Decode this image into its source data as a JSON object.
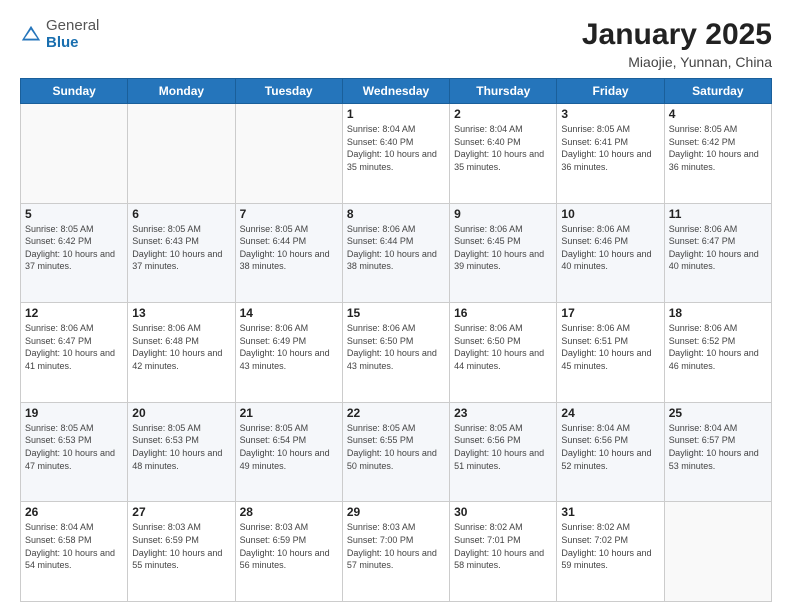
{
  "header": {
    "logo_general": "General",
    "logo_blue": "Blue",
    "title": "January 2025",
    "subtitle": "Miaojie, Yunnan, China"
  },
  "weekdays": [
    "Sunday",
    "Monday",
    "Tuesday",
    "Wednesday",
    "Thursday",
    "Friday",
    "Saturday"
  ],
  "weeks": [
    [
      {
        "day": "",
        "sunrise": "",
        "sunset": "",
        "daylight": ""
      },
      {
        "day": "",
        "sunrise": "",
        "sunset": "",
        "daylight": ""
      },
      {
        "day": "",
        "sunrise": "",
        "sunset": "",
        "daylight": ""
      },
      {
        "day": "1",
        "sunrise": "Sunrise: 8:04 AM",
        "sunset": "Sunset: 6:40 PM",
        "daylight": "Daylight: 10 hours and 35 minutes."
      },
      {
        "day": "2",
        "sunrise": "Sunrise: 8:04 AM",
        "sunset": "Sunset: 6:40 PM",
        "daylight": "Daylight: 10 hours and 35 minutes."
      },
      {
        "day": "3",
        "sunrise": "Sunrise: 8:05 AM",
        "sunset": "Sunset: 6:41 PM",
        "daylight": "Daylight: 10 hours and 36 minutes."
      },
      {
        "day": "4",
        "sunrise": "Sunrise: 8:05 AM",
        "sunset": "Sunset: 6:42 PM",
        "daylight": "Daylight: 10 hours and 36 minutes."
      }
    ],
    [
      {
        "day": "5",
        "sunrise": "Sunrise: 8:05 AM",
        "sunset": "Sunset: 6:42 PM",
        "daylight": "Daylight: 10 hours and 37 minutes."
      },
      {
        "day": "6",
        "sunrise": "Sunrise: 8:05 AM",
        "sunset": "Sunset: 6:43 PM",
        "daylight": "Daylight: 10 hours and 37 minutes."
      },
      {
        "day": "7",
        "sunrise": "Sunrise: 8:05 AM",
        "sunset": "Sunset: 6:44 PM",
        "daylight": "Daylight: 10 hours and 38 minutes."
      },
      {
        "day": "8",
        "sunrise": "Sunrise: 8:06 AM",
        "sunset": "Sunset: 6:44 PM",
        "daylight": "Daylight: 10 hours and 38 minutes."
      },
      {
        "day": "9",
        "sunrise": "Sunrise: 8:06 AM",
        "sunset": "Sunset: 6:45 PM",
        "daylight": "Daylight: 10 hours and 39 minutes."
      },
      {
        "day": "10",
        "sunrise": "Sunrise: 8:06 AM",
        "sunset": "Sunset: 6:46 PM",
        "daylight": "Daylight: 10 hours and 40 minutes."
      },
      {
        "day": "11",
        "sunrise": "Sunrise: 8:06 AM",
        "sunset": "Sunset: 6:47 PM",
        "daylight": "Daylight: 10 hours and 40 minutes."
      }
    ],
    [
      {
        "day": "12",
        "sunrise": "Sunrise: 8:06 AM",
        "sunset": "Sunset: 6:47 PM",
        "daylight": "Daylight: 10 hours and 41 minutes."
      },
      {
        "day": "13",
        "sunrise": "Sunrise: 8:06 AM",
        "sunset": "Sunset: 6:48 PM",
        "daylight": "Daylight: 10 hours and 42 minutes."
      },
      {
        "day": "14",
        "sunrise": "Sunrise: 8:06 AM",
        "sunset": "Sunset: 6:49 PM",
        "daylight": "Daylight: 10 hours and 43 minutes."
      },
      {
        "day": "15",
        "sunrise": "Sunrise: 8:06 AM",
        "sunset": "Sunset: 6:50 PM",
        "daylight": "Daylight: 10 hours and 43 minutes."
      },
      {
        "day": "16",
        "sunrise": "Sunrise: 8:06 AM",
        "sunset": "Sunset: 6:50 PM",
        "daylight": "Daylight: 10 hours and 44 minutes."
      },
      {
        "day": "17",
        "sunrise": "Sunrise: 8:06 AM",
        "sunset": "Sunset: 6:51 PM",
        "daylight": "Daylight: 10 hours and 45 minutes."
      },
      {
        "day": "18",
        "sunrise": "Sunrise: 8:06 AM",
        "sunset": "Sunset: 6:52 PM",
        "daylight": "Daylight: 10 hours and 46 minutes."
      }
    ],
    [
      {
        "day": "19",
        "sunrise": "Sunrise: 8:05 AM",
        "sunset": "Sunset: 6:53 PM",
        "daylight": "Daylight: 10 hours and 47 minutes."
      },
      {
        "day": "20",
        "sunrise": "Sunrise: 8:05 AM",
        "sunset": "Sunset: 6:53 PM",
        "daylight": "Daylight: 10 hours and 48 minutes."
      },
      {
        "day": "21",
        "sunrise": "Sunrise: 8:05 AM",
        "sunset": "Sunset: 6:54 PM",
        "daylight": "Daylight: 10 hours and 49 minutes."
      },
      {
        "day": "22",
        "sunrise": "Sunrise: 8:05 AM",
        "sunset": "Sunset: 6:55 PM",
        "daylight": "Daylight: 10 hours and 50 minutes."
      },
      {
        "day": "23",
        "sunrise": "Sunrise: 8:05 AM",
        "sunset": "Sunset: 6:56 PM",
        "daylight": "Daylight: 10 hours and 51 minutes."
      },
      {
        "day": "24",
        "sunrise": "Sunrise: 8:04 AM",
        "sunset": "Sunset: 6:56 PM",
        "daylight": "Daylight: 10 hours and 52 minutes."
      },
      {
        "day": "25",
        "sunrise": "Sunrise: 8:04 AM",
        "sunset": "Sunset: 6:57 PM",
        "daylight": "Daylight: 10 hours and 53 minutes."
      }
    ],
    [
      {
        "day": "26",
        "sunrise": "Sunrise: 8:04 AM",
        "sunset": "Sunset: 6:58 PM",
        "daylight": "Daylight: 10 hours and 54 minutes."
      },
      {
        "day": "27",
        "sunrise": "Sunrise: 8:03 AM",
        "sunset": "Sunset: 6:59 PM",
        "daylight": "Daylight: 10 hours and 55 minutes."
      },
      {
        "day": "28",
        "sunrise": "Sunrise: 8:03 AM",
        "sunset": "Sunset: 6:59 PM",
        "daylight": "Daylight: 10 hours and 56 minutes."
      },
      {
        "day": "29",
        "sunrise": "Sunrise: 8:03 AM",
        "sunset": "Sunset: 7:00 PM",
        "daylight": "Daylight: 10 hours and 57 minutes."
      },
      {
        "day": "30",
        "sunrise": "Sunrise: 8:02 AM",
        "sunset": "Sunset: 7:01 PM",
        "daylight": "Daylight: 10 hours and 58 minutes."
      },
      {
        "day": "31",
        "sunrise": "Sunrise: 8:02 AM",
        "sunset": "Sunset: 7:02 PM",
        "daylight": "Daylight: 10 hours and 59 minutes."
      },
      {
        "day": "",
        "sunrise": "",
        "sunset": "",
        "daylight": ""
      }
    ]
  ]
}
